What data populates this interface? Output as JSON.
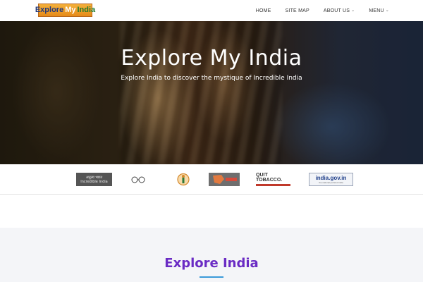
{
  "header": {
    "logo": {
      "word1": "Explore",
      "word2": "My",
      "word3": "India"
    },
    "nav": [
      {
        "label": "HOME",
        "has_dropdown": false
      },
      {
        "label": "SITE MAP",
        "has_dropdown": false
      },
      {
        "label": "ABOUT US",
        "has_dropdown": true
      },
      {
        "label": "MENU",
        "has_dropdown": true
      }
    ]
  },
  "hero": {
    "title": "Explore My India",
    "subtitle": "Explore India to discover the mystique of Incredible India"
  },
  "partners": {
    "incredible_india": {
      "line1": "अतुल्य भारत",
      "line2": "Incredible India"
    },
    "quit_tobacco": {
      "label": "QUIT TOBACCO."
    },
    "india_gov": {
      "label": "india.gov.in",
      "tagline": "the national portal of india"
    }
  },
  "section": {
    "title": "Explore India"
  },
  "colors": {
    "section_title": "#6a2bc4",
    "underline": "#3a9ad9",
    "logo_orange": "#e58a1a"
  }
}
